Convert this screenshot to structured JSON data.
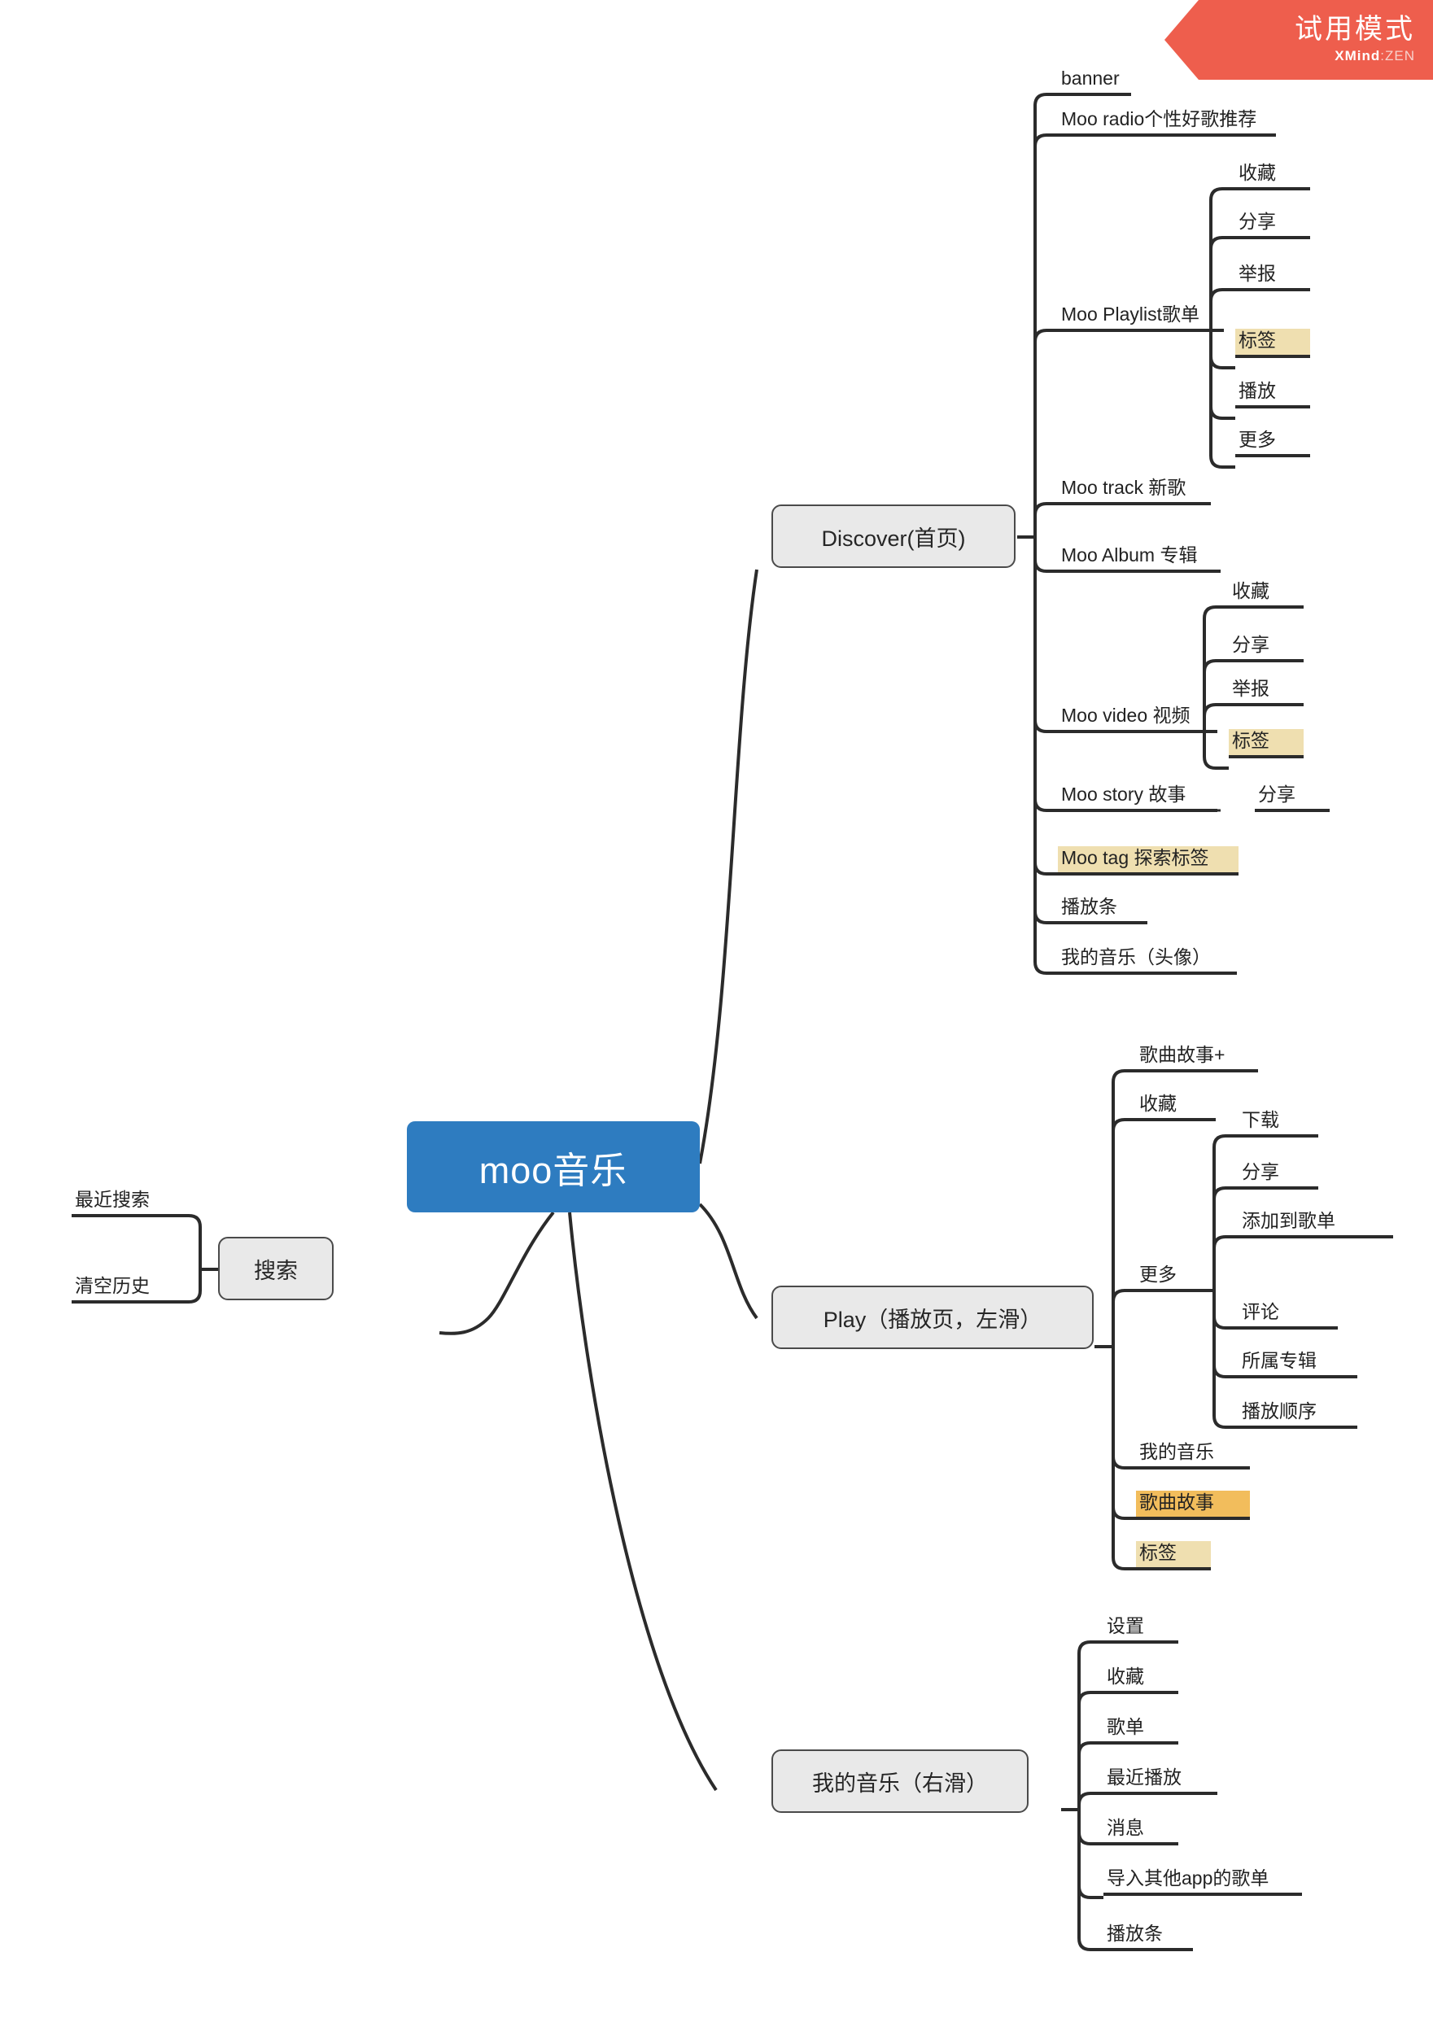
{
  "app": {
    "tool": "XMind:ZEN",
    "trial_badge": "试用模式",
    "brand_primary": "XMind",
    "brand_secondary": ":ZEN"
  },
  "colors": {
    "root_fill": "#2e7cc0",
    "main_fill": "#e9e9e9",
    "main_border": "#4a4a4a",
    "line": "#2b2b2b",
    "highlight_tan": "#efdfb0",
    "highlight_orange": "#f2bd5c",
    "ribbon": "#ee5e4d"
  },
  "mindmap": {
    "root": "moo音乐",
    "branches": {
      "search": {
        "label": "搜索",
        "children": [
          "最近搜索",
          "清空历史"
        ]
      },
      "discover": {
        "label": "Discover(首页)",
        "children": [
          {
            "label": "banner"
          },
          {
            "label": "Moo radio个性好歌推荐"
          },
          {
            "label": "Moo Playlist歌单",
            "children": [
              "收藏",
              "分享",
              "举报",
              "标签",
              "播放",
              "更多"
            ]
          },
          {
            "label": "Moo track 新歌"
          },
          {
            "label": "Moo Album  专辑"
          },
          {
            "label": "Moo video 视频",
            "children": [
              "收藏",
              "分享",
              "举报",
              "标签"
            ]
          },
          {
            "label": "Moo story 故事",
            "children": [
              "分享"
            ]
          },
          {
            "label": "Moo tag 探索标签"
          },
          {
            "label": "播放条"
          },
          {
            "label": "我的音乐（头像）"
          }
        ]
      },
      "play": {
        "label": "Play（播放页，左滑）",
        "children": [
          {
            "label": "歌曲故事+"
          },
          {
            "label": "收藏"
          },
          {
            "label": "更多",
            "children": [
              "下载",
              "分享",
              "添加到歌单",
              "评论",
              "所属专辑",
              "播放顺序"
            ]
          },
          {
            "label": "我的音乐"
          },
          {
            "label": "歌曲故事"
          },
          {
            "label": "标签"
          }
        ]
      },
      "mymusic": {
        "label": "我的音乐（右滑）",
        "children": [
          {
            "label": "设置"
          },
          {
            "label": "收藏"
          },
          {
            "label": "歌单"
          },
          {
            "label": "最近播放"
          },
          {
            "label": "消息"
          },
          {
            "label": "导入其他app的歌单"
          },
          {
            "label": "播放条"
          }
        ]
      }
    }
  }
}
